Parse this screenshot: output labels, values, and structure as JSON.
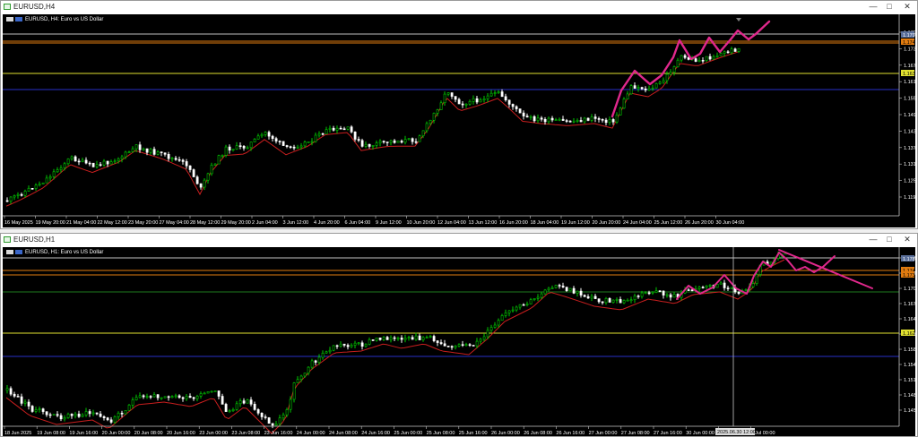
{
  "window_top": {
    "title": "EURUSD,H4"
  },
  "window_bottom": {
    "title": "EURUSD,H1"
  },
  "controls": {
    "minimize": "—",
    "maximize": "□",
    "close": "✕"
  },
  "chart_top": {
    "label": "EURUSD, H4: Euro vs US Dollar",
    "price_labels": [
      "1.179",
      "1.173",
      "1.167",
      "1.161",
      "1.155",
      "1.149",
      "1.143",
      "1.137",
      "1.131",
      "1.125",
      "1.119"
    ],
    "badges": [
      {
        "text": "1.1795",
        "bg": "#5a6f9a",
        "fg": "#ffffff"
      },
      {
        "text": "1.174",
        "bg": "#e07b10",
        "fg": "#000000"
      },
      {
        "text": "1.1632",
        "bg": "#e0e030",
        "fg": "#000000"
      }
    ],
    "time_labels": [
      "16 May 2025",
      "19 May 20:00",
      "21 May 04:00",
      "22 May 12:00",
      "23 May 20:00",
      "27 May 04:00",
      "28 May 12:00",
      "29 May 20:00",
      "2 Jun 04:00",
      "3 Jun 12:00",
      "4 Jun 20:00",
      "6 Jun 04:00",
      "9 Jun 12:00",
      "10 Jun 20:00",
      "12 Jun 04:00",
      "13 Jun 12:00",
      "16 Jun 20:00",
      "18 Jun 04:00",
      "19 Jun 12:00",
      "20 Jun 20:00",
      "24 Jun 04:00",
      "25 Jun 12:00",
      "26 Jun 20:00",
      "30 Jun 04:00"
    ]
  },
  "chart_bottom": {
    "label": "EURUSD, H1: Euro vs US Dollar",
    "price_labels": [
      "1.17720",
      "1.17400",
      "1.17080",
      "1.16760",
      "1.16440",
      "1.16120",
      "1.15800",
      "1.15480",
      "1.15160",
      "1.14840",
      "1.14520"
    ],
    "badges": [
      {
        "text": "1.17890",
        "bg": "#5a6f9a",
        "fg": "#ffffff"
      },
      {
        "text": "1.17455",
        "bg": "#e07b10",
        "fg": "#000000"
      },
      {
        "text": "1.17380",
        "bg": "#e07b10",
        "fg": "#000000"
      },
      {
        "text": "1.16250",
        "bg": "#e0e030",
        "fg": "#000000"
      }
    ],
    "crosshair_label": "2025.06.30 12:00",
    "time_labels": [
      "18 Jun 2025",
      "19 Jun 08:00",
      "19 Jun 16:00",
      "20 Jun 00:00",
      "20 Jun 08:00",
      "20 Jun 16:00",
      "23 Jun 00:00",
      "23 Jun 08:00",
      "23 Jun 16:00",
      "24 Jun 00:00",
      "24 Jun 08:00",
      "24 Jun 16:00",
      "25 Jun 00:00",
      "25 Jun 08:00",
      "25 Jun 16:00",
      "26 Jun 00:00",
      "26 Jun 08:00",
      "26 Jun 16:00",
      "27 Jun 00:00",
      "27 Jun 08:00",
      "27 Jun 16:00",
      "30 Jun 00:00",
      "",
      "1 Jul 00:00"
    ]
  },
  "colors": {
    "background": "#000000",
    "bull_candle": "#00c800",
    "bear_candle": "#ffffff",
    "moving_average": "#c81e1e",
    "annotation": "#e0288c",
    "resistance_orange": "#e07b10",
    "support_yellow": "#e0e030",
    "support_blue": "#2830c8",
    "price_line": "#c0c0c0"
  }
}
